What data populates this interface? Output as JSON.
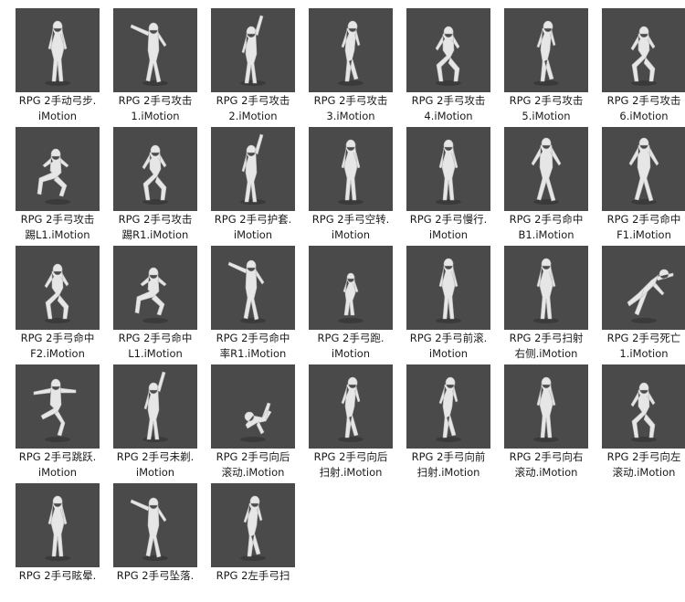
{
  "files": [
    {
      "line1": "RPG 2手动弓步.",
      "line2": "iMotion",
      "pose": "stand"
    },
    {
      "line1": "RPG 2手弓攻击",
      "line2": "1.iMotion",
      "pose": "armout"
    },
    {
      "line1": "RPG 2手弓攻击",
      "line2": "2.iMotion",
      "pose": "armup"
    },
    {
      "line1": "RPG 2手弓攻击",
      "line2": "3.iMotion",
      "pose": "lean"
    },
    {
      "line1": "RPG 2手弓攻击",
      "line2": "4.iMotion",
      "pose": "crouch"
    },
    {
      "line1": "RPG 2手弓攻击",
      "line2": "5.iMotion",
      "pose": "lean"
    },
    {
      "line1": "RPG 2手弓攻击",
      "line2": "6.iMotion",
      "pose": "crouch"
    },
    {
      "line1": "RPG 2手弓攻击",
      "line2": "踢L1.iMotion",
      "pose": "sit"
    },
    {
      "line1": "RPG 2手弓攻击",
      "line2": "踢R1.iMotion",
      "pose": "crouch"
    },
    {
      "line1": "RPG 2手弓护套.",
      "line2": "iMotion",
      "pose": "armup"
    },
    {
      "line1": "RPG 2手弓空转.",
      "line2": "iMotion",
      "pose": "stand"
    },
    {
      "line1": "RPG 2手弓慢行.",
      "line2": "iMotion",
      "pose": "stand"
    },
    {
      "line1": "RPG 2手弓命中",
      "line2": "B1.iMotion",
      "pose": "wide"
    },
    {
      "line1": "RPG 2手弓命中",
      "line2": "F1.iMotion",
      "pose": "wide"
    },
    {
      "line1": "RPG 2手弓命中",
      "line2": "F2.iMotion",
      "pose": "crouch"
    },
    {
      "line1": "RPG 2手弓命中",
      "line2": "L1.iMotion",
      "pose": "sit"
    },
    {
      "line1": "RPG 2手弓命中",
      "line2": "率R1.iMotion",
      "pose": "armout"
    },
    {
      "line1": "RPG 2手弓跑.",
      "line2": "iMotion",
      "pose": "small"
    },
    {
      "line1": "RPG 2手弓前滚.",
      "line2": "iMotion",
      "pose": "stand"
    },
    {
      "line1": "RPG 2手弓扫射",
      "line2": "右侧.iMotion",
      "pose": "stand"
    },
    {
      "line1": "RPG 2手弓死亡",
      "line2": "1.iMotion",
      "pose": "fall"
    },
    {
      "line1": "RPG 2手弓跳跃.",
      "line2": "iMotion",
      "pose": "jump"
    },
    {
      "line1": "RPG 2手弓未剃.",
      "line2": "iMotion",
      "pose": "armup"
    },
    {
      "line1": "RPG 2手弓向后",
      "line2": "滚动.iMotion",
      "pose": "roll"
    },
    {
      "line1": "RPG 2手弓向后",
      "line2": "扫射.iMotion",
      "pose": "lean"
    },
    {
      "line1": "RPG 2手弓向前",
      "line2": "扫射.iMotion",
      "pose": "lean"
    },
    {
      "line1": "RPG 2手弓向右",
      "line2": "滚动.iMotion",
      "pose": "stand"
    },
    {
      "line1": "RPG 2手弓向左",
      "line2": "滚动.iMotion",
      "pose": "crouch"
    },
    {
      "line1": "RPG 2手弓眩晕.",
      "line2": "",
      "pose": "stand"
    },
    {
      "line1": "RPG 2手弓坠落.",
      "line2": "",
      "pose": "armout"
    },
    {
      "line1": "RPG 2左手弓扫",
      "line2": "",
      "pose": "lean"
    }
  ]
}
